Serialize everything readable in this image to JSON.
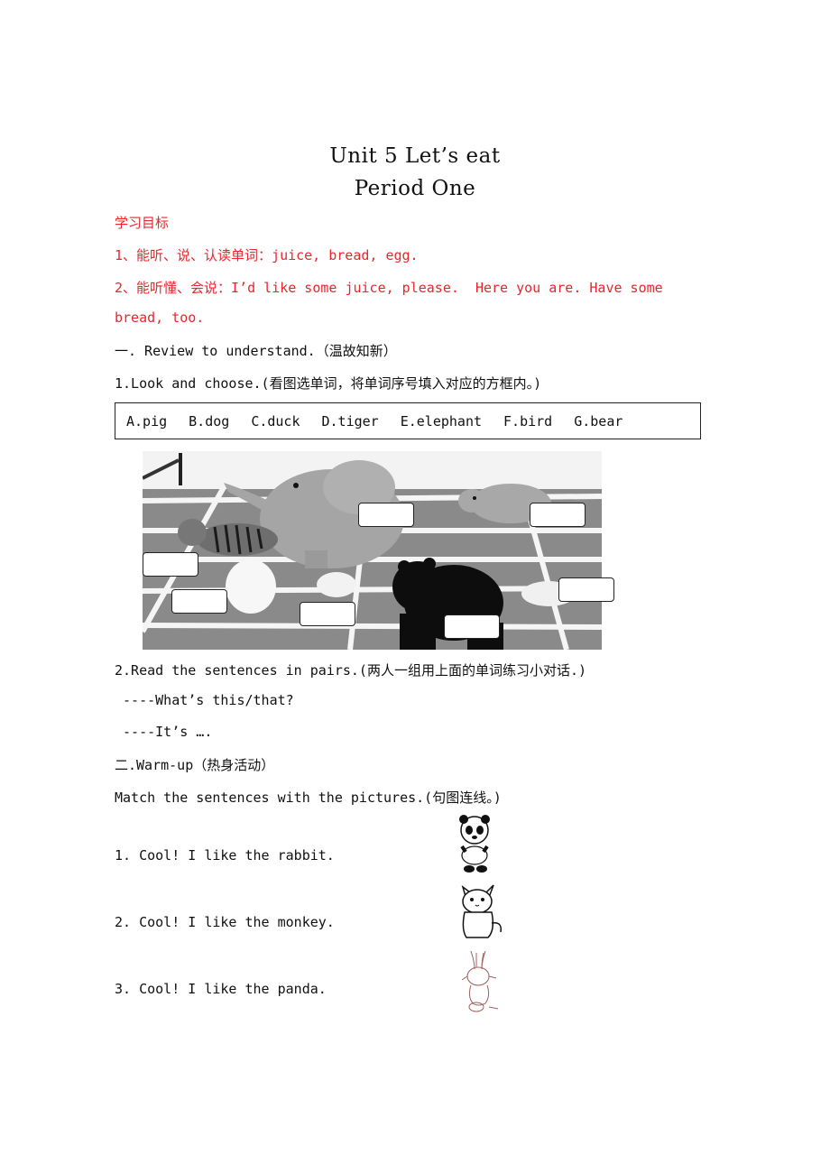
{
  "header": {
    "title": "Unit 5    Let’s eat",
    "subtitle": "Period One"
  },
  "objectives": {
    "heading": "学习目标",
    "items": [
      "1、能听、说、认读单词：juice, bread, egg.",
      "2、能听懂、会说：I’d like some juice, please.  Here you are. Have some",
      "bread, too."
    ],
    "color": "#e8262e"
  },
  "section1": {
    "heading": "一. Review to understand.（温故知新）",
    "task1": {
      "instruction": "1.Look and choose.(看图选单词，将单词序号填入对应的方框内。)",
      "options": [
        "A.pig",
        "B.dog",
        "C.duck",
        "D.tiger",
        "E.elephant",
        "F.bird",
        "G.bear"
      ],
      "picture_desc": "animals running on a track: tiger, elephant, pig, rabbit, duck, bear, dog",
      "answer_boxes": 7
    },
    "task2": {
      "instruction": "2.Read the sentences in pairs.(两人一组用上面的单词练习小对话.)",
      "dialogue": [
        " ----What’s this/that?",
        " ----It’s ….  "
      ]
    }
  },
  "section2": {
    "heading": "二.Warm-up（热身活动）",
    "instruction": "Match the sentences with the pictures.(句图连线。)",
    "sentences": [
      "1. Cool! I like the rabbit.",
      "2. Cool! I like the monkey.",
      "3. Cool! I like the panda."
    ],
    "pictures": [
      "panda",
      "cat",
      "rabbit"
    ]
  }
}
